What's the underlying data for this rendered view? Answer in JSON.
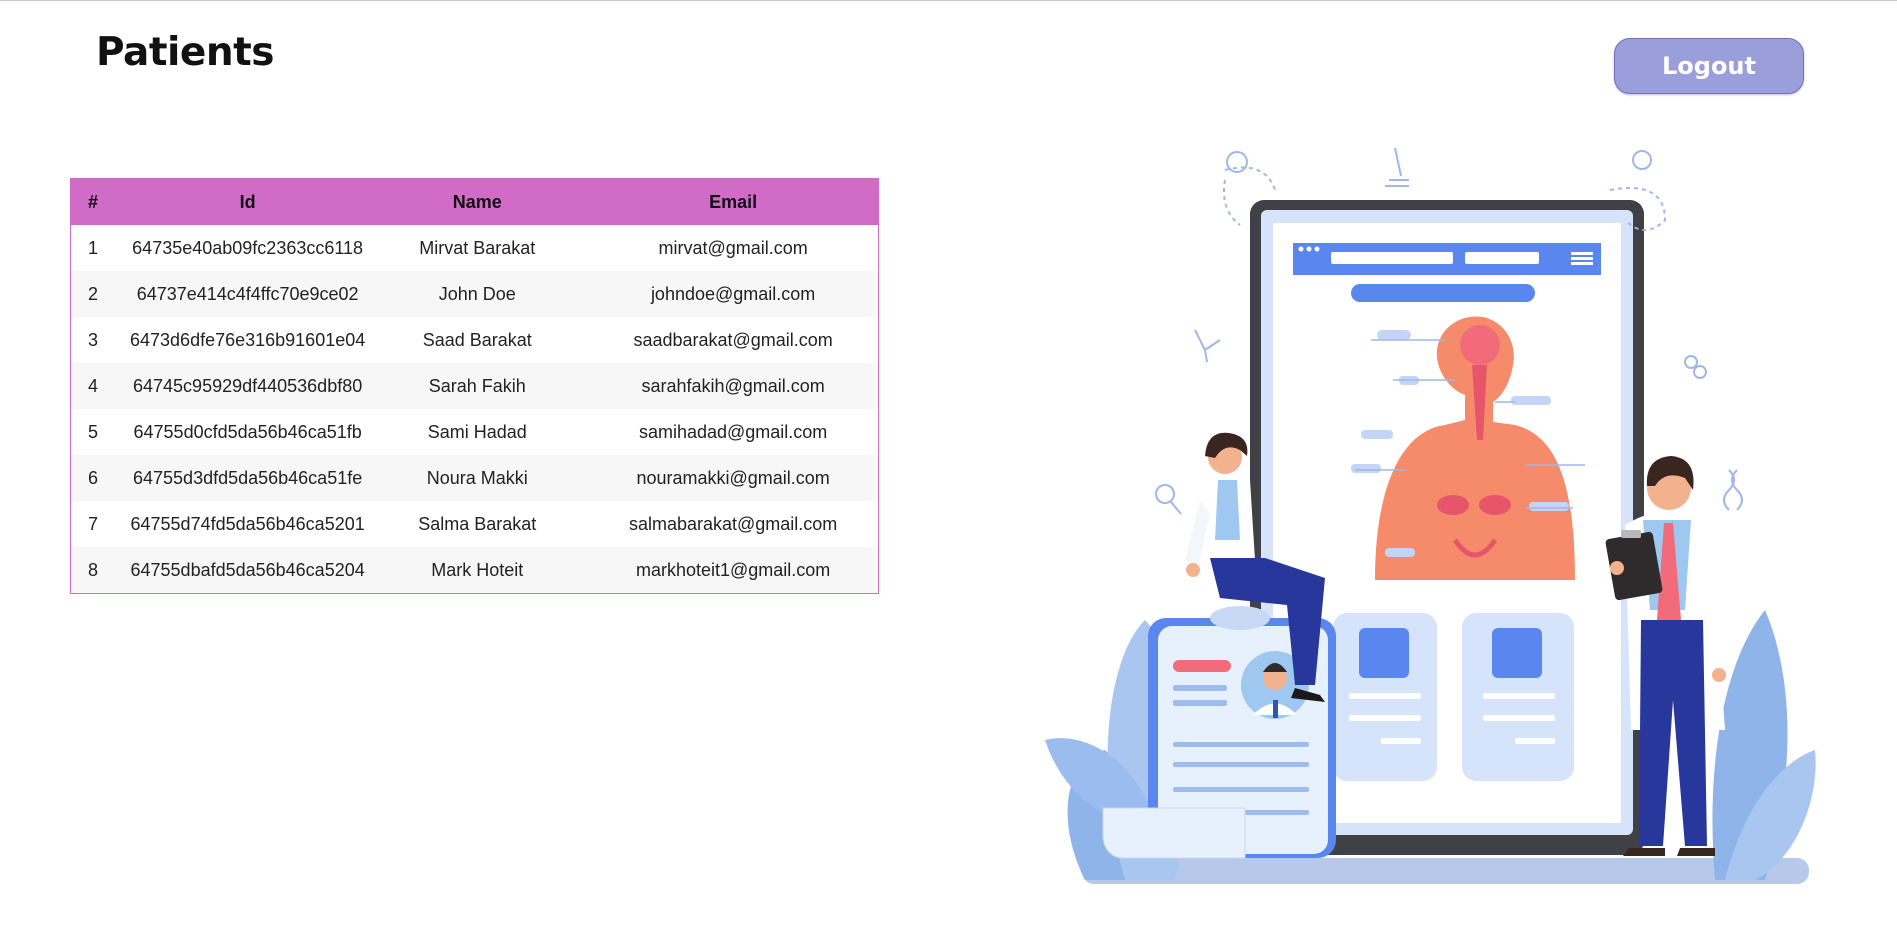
{
  "header": {
    "title": "Patients",
    "logout_label": "Logout"
  },
  "colors": {
    "table_header": "#d06bc7",
    "logout_button": "#9a9fdc"
  },
  "table": {
    "columns": [
      "#",
      "Id",
      "Name",
      "Email"
    ],
    "rows": [
      {
        "num": "1",
        "id": "64735e40ab09fc2363cc6118",
        "name": "Mirvat Barakat",
        "email": "mirvat@gmail.com"
      },
      {
        "num": "2",
        "id": "64737e414c4f4ffc70e9ce02",
        "name": "John Doe",
        "email": "johndoe@gmail.com"
      },
      {
        "num": "3",
        "id": "6473d6dfe76e316b91601e04",
        "name": "Saad Barakat",
        "email": "saadbarakat@gmail.com"
      },
      {
        "num": "4",
        "id": "64745c95929df440536dbf80",
        "name": "Sarah Fakih",
        "email": "sarahfakih@gmail.com"
      },
      {
        "num": "5",
        "id": "64755d0cfd5da56b46ca51fb",
        "name": "Sami Hadad",
        "email": "samihadad@gmail.com"
      },
      {
        "num": "6",
        "id": "64755d3dfd5da56b46ca51fe",
        "name": "Noura Makki",
        "email": "nouramakki@gmail.com"
      },
      {
        "num": "7",
        "id": "64755d74fd5da56b46ca5201",
        "name": "Salma Barakat",
        "email": "salmabarakat@gmail.com"
      },
      {
        "num": "8",
        "id": "64755dbafd5da56b46ca5204",
        "name": "Mark Hoteit",
        "email": "markhoteit1@gmail.com"
      }
    ]
  },
  "illustration": {
    "icon": "medical-tablet-illustration"
  }
}
